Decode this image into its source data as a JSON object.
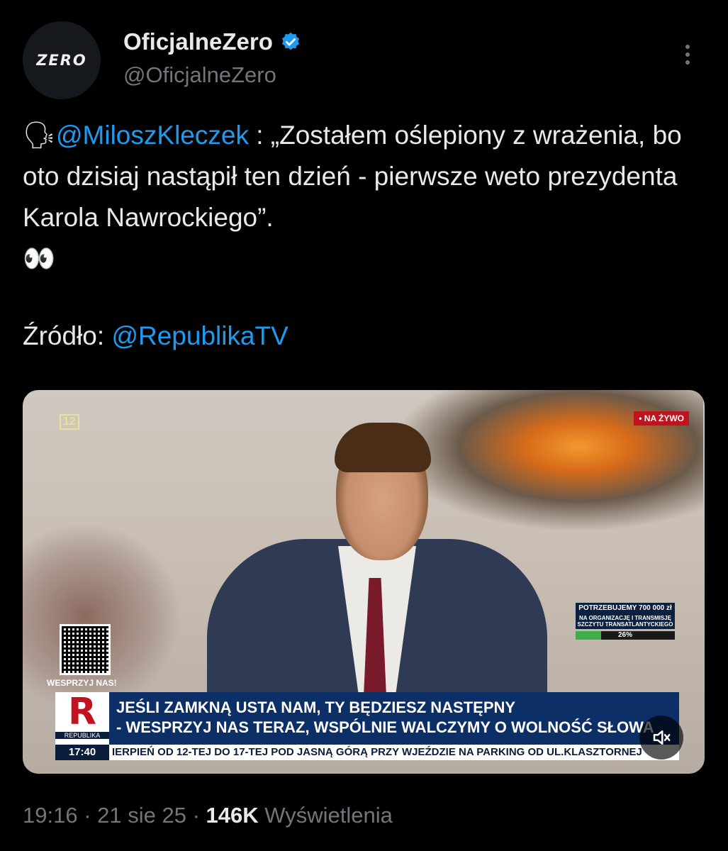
{
  "header": {
    "avatar_text": "ZERO",
    "display_name": "OficjalneZero",
    "handle": "@OficjalneZero"
  },
  "tweet": {
    "speaker_emoji": "🗣",
    "mention": "@MiloszKleczek",
    "quote": " : „Zostałem oślepiony z wrażenia, bo oto dzisiaj nastąpił ten dzień - pierwsze weto prezydenta Karola Nawrockiego”.",
    "eyes_emoji": "👀",
    "source_label": "Źródło: ",
    "source_mention": "@RepublikaTV"
  },
  "video": {
    "channel_number": "12",
    "live_badge": "• NA ŻYWO",
    "donate_label": "WESPRZYJ NAS!",
    "goal_title": "POTRZEBUJEMY 700 000 zł",
    "goal_subtitle": "NA ORGANIZACJĘ I TRANSMISJĘ SZCZYTU TRANSATLANTYCKIEGO",
    "goal_percent": "26%",
    "goal_fraction": 0.26,
    "logo_letter": "R",
    "logo_name": "REPUBLIKA",
    "clock": "17:40",
    "headline_line1": "JEŚLI ZAMKNĄ USTA NAM, TY BĘDZIESZ NASTĘPNY",
    "headline_line2": "- WESPRZYJ NAS TERAZ, WSPÓLNIE WALCZYMY O WOLNOŚĆ SŁOWA",
    "ticker": "IERPIEŃ OD 12-TEJ DO 17-TEJ POD JASNĄ GÓRĄ PRZY WJEŹDZIE NA PARKING OD UL.KLASZTORNEJ"
  },
  "footer": {
    "time": "19:16",
    "separator": " · ",
    "date": "21 sie 25",
    "views": "146K",
    "views_label": " Wyświetlenia"
  },
  "colors": {
    "accent_link": "#1d9bf0",
    "verified": "#1d9bf0",
    "muted": "#71767b"
  }
}
